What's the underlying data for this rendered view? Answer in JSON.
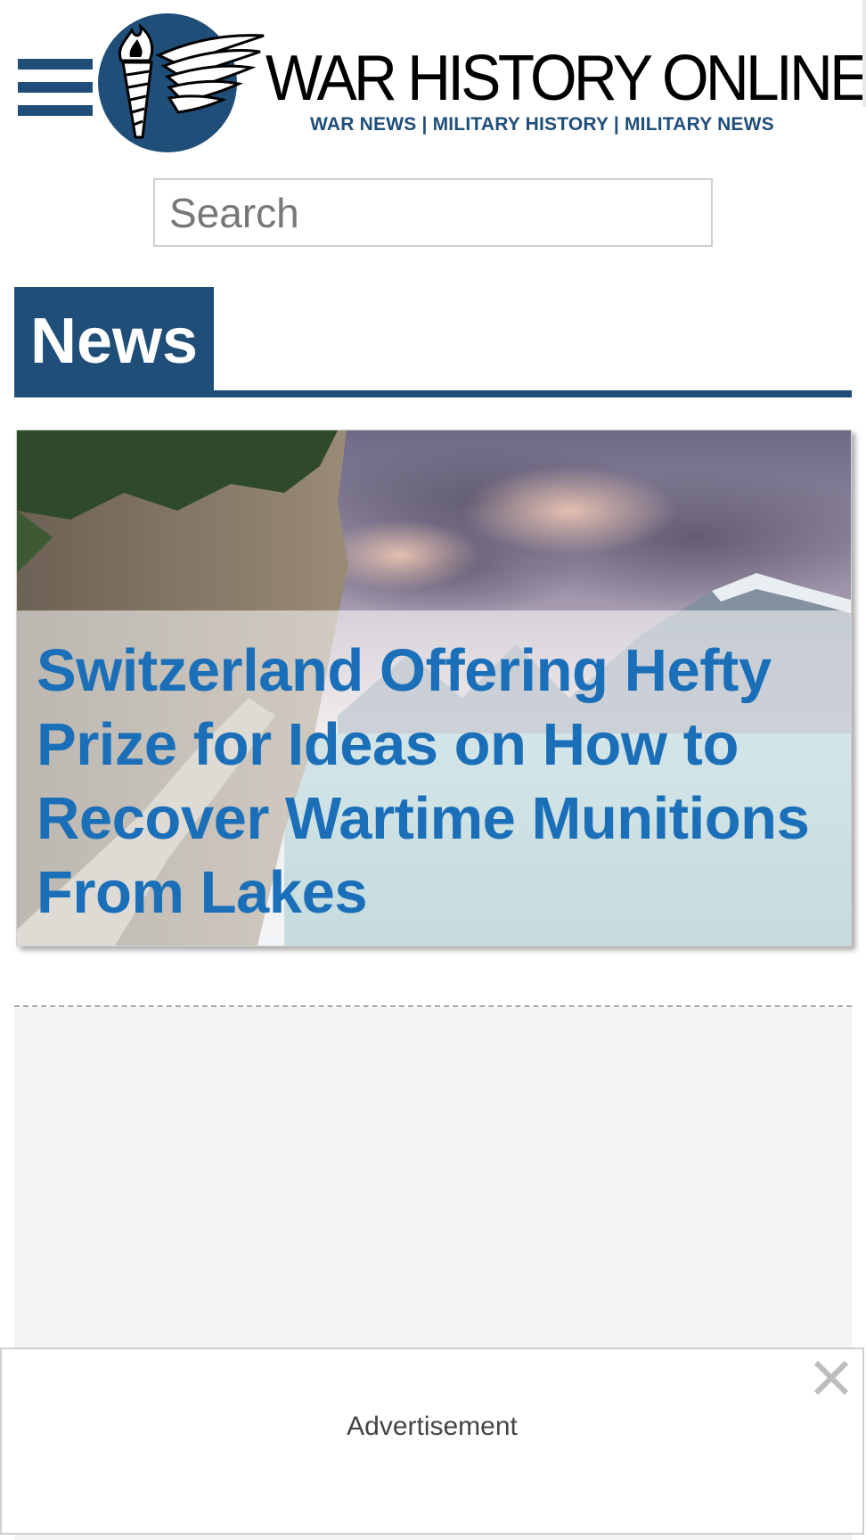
{
  "header": {
    "site_title": "WAR HISTORY ONLINE",
    "tagline": "WAR NEWS | MILITARY HISTORY | MILITARY NEWS",
    "menu_icon": "hamburger-menu-icon",
    "logo_icon": "winged-torch-emblem",
    "brand_color": "#1f4e79"
  },
  "search": {
    "placeholder": "Search",
    "value": ""
  },
  "section": {
    "title": "News"
  },
  "featured_article": {
    "title": "Switzerland Offering Hefty Prize for Ideas on How to Recover Wartime Munitions From Lakes",
    "title_color": "#1a6fb8"
  },
  "sticky_ad": {
    "label": "Advertisement",
    "close_icon": "close-icon"
  }
}
